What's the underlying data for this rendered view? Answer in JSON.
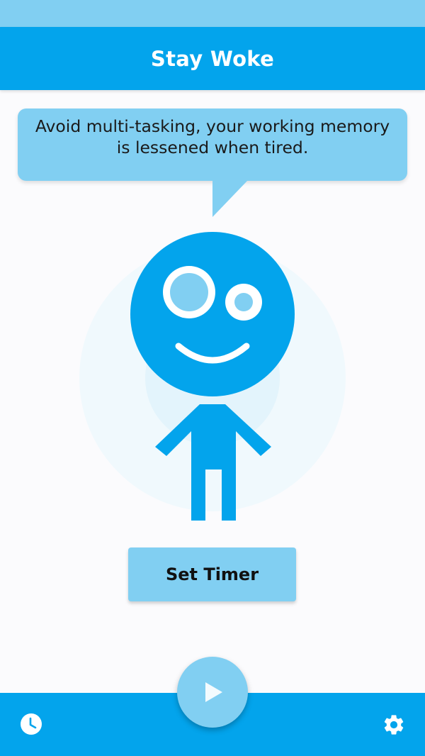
{
  "app": {
    "title": "Stay Woke"
  },
  "tip": {
    "text": "Avoid multi-tasking, your working memory is lessened when tired."
  },
  "actions": {
    "set_timer_label": "Set Timer"
  },
  "icons": {
    "play": "play-icon",
    "history": "clock-icon",
    "settings": "gear-icon"
  },
  "colors": {
    "primary": "#03a4ec",
    "light": "#81cff2",
    "halo_outer": "#f0f9fd",
    "halo_inner": "#e3f4fc",
    "background": "#fbfbfd"
  }
}
